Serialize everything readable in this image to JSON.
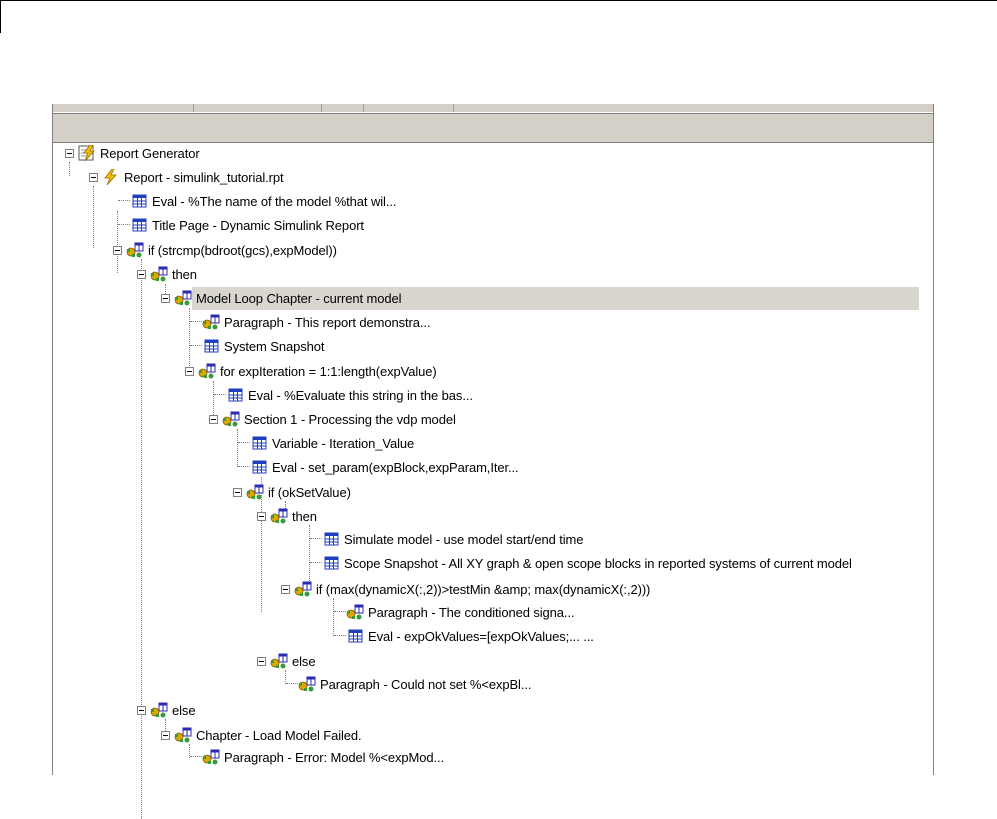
{
  "report_tree": {
    "nodes": [
      {
        "label": "Report Generator",
        "icon": "report-generator-icon"
      },
      {
        "label": "Report - simulink_tutorial.rpt",
        "icon": "lightning-report-icon"
      },
      {
        "label": "Eval - %The name of the model %that wil...",
        "icon": "table-component-icon"
      },
      {
        "label": "Title Page - Dynamic Simulink Report",
        "icon": "table-component-icon"
      },
      {
        "label": "if (strcmp(bdroot(gcs),expModel))",
        "icon": "logic-component-icon"
      },
      {
        "label": "then",
        "icon": "logic-component-icon"
      },
      {
        "label": "Model Loop Chapter - current model",
        "icon": "logic-component-icon"
      },
      {
        "label": "Paragraph - This report demonstra...",
        "icon": "logic-component-icon"
      },
      {
        "label": "System Snapshot",
        "icon": "table-component-icon"
      },
      {
        "label": "for expIteration = 1:1:length(expValue)",
        "icon": "logic-component-icon"
      },
      {
        "label": "Eval - %Evaluate this string in the bas...",
        "icon": "table-component-icon"
      },
      {
        "label": "Section 1 - Processing the vdp model",
        "icon": "logic-component-icon"
      },
      {
        "label": "Variable - Iteration_Value",
        "icon": "table-component-icon"
      },
      {
        "label": "Eval - set_param(expBlock,expParam,Iter...",
        "icon": "table-component-icon"
      },
      {
        "label": "if (okSetValue)",
        "icon": "logic-component-icon"
      },
      {
        "label": "then",
        "icon": "logic-component-icon"
      },
      {
        "label": "Simulate model - use model start/end time",
        "icon": "table-component-icon"
      },
      {
        "label": "Scope Snapshot - All XY graph & open scope blocks in reported systems of current model",
        "icon": "table-component-icon"
      },
      {
        "label": "if (max(dynamicX(:,2))>testMin &amp; max(dynamicX(:,2)))",
        "icon": "logic-component-icon"
      },
      {
        "label": "Paragraph - The conditioned signa...",
        "icon": "logic-component-icon"
      },
      {
        "label": "Eval - expOkValues=[expOkValues;...     ...",
        "icon": "table-component-icon"
      },
      {
        "label": "else",
        "icon": "logic-component-icon"
      },
      {
        "label": "Paragraph - Could not set %<expBl...",
        "icon": "logic-component-icon"
      },
      {
        "label": "else",
        "icon": "logic-component-icon"
      },
      {
        "label": "Chapter - Load Model Failed.",
        "icon": "logic-component-icon"
      },
      {
        "label": "Paragraph - Error: Model %<expMod...",
        "icon": "logic-component-icon"
      }
    ],
    "selected_label": "Model Loop Chapter - current model"
  },
  "colors": {
    "selection": "#d9d6d0",
    "chrome": "#d4d0c8",
    "table_icon": "#1f3fbf",
    "logic_icon_green": "#3a9a3a",
    "logic_icon_gold": "#d8a800",
    "lightning": "#f2c200"
  }
}
